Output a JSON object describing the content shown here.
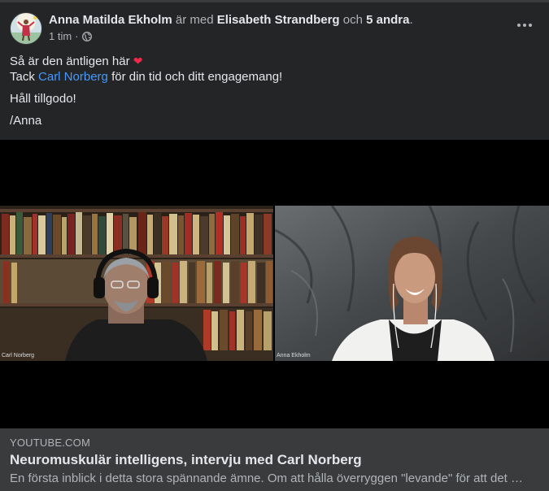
{
  "post": {
    "author": "Anna Matilda Ekholm",
    "with_word": "är med",
    "tagged": "Elisabeth Strandberg",
    "and_word": "och",
    "others": "5 andra",
    "period": ".",
    "time": "1 tim",
    "separator": "·",
    "privacy_icon": "globe-icon",
    "more_icon": "more-options-icon"
  },
  "body": {
    "line1": "Så är den äntligen här",
    "heart": "❤",
    "line2_prefix": "Tack",
    "line2_link": "Carl Norberg",
    "line2_suffix": "för din tid och ditt engagemang!",
    "line3": "Håll tillgodo!",
    "line4": "/Anna"
  },
  "video": {
    "left_name": "Carl Norberg",
    "right_name": "Anna Ekholm"
  },
  "link_preview": {
    "domain": "YOUTUBE.COM",
    "title": "Neuromuskulär intelligens, intervju med Carl Norberg",
    "description": "En första inblick i detta stora spännande ämne. Om att hålla överryggen \"levande\" för att det …"
  },
  "colors": {
    "background": "#242526",
    "link": "#4599ff",
    "heart": "#f02849",
    "preview_bg": "#3a3b3c"
  }
}
